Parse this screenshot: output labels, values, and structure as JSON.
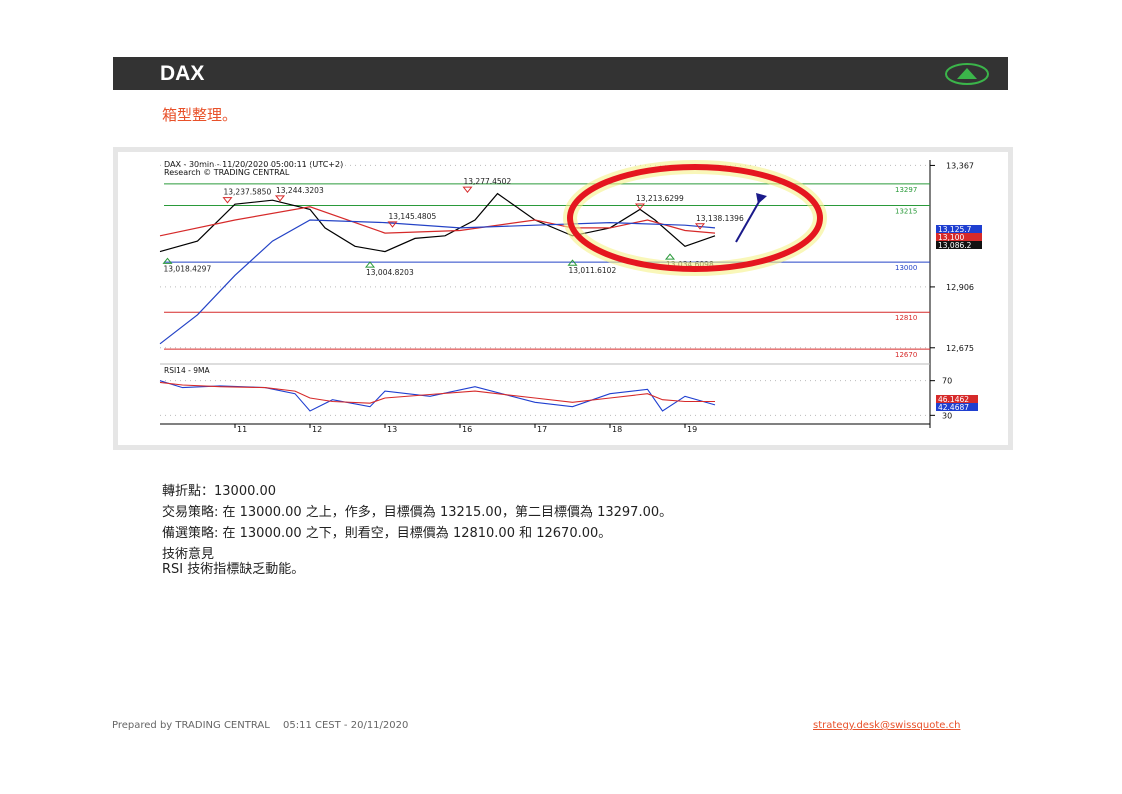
{
  "header": {
    "title": "DAX",
    "trend_icon": "up-arrow-icon",
    "trend_color": "#3bb54a"
  },
  "subtitle": "箱型整理。",
  "chart_data": {
    "type": "line",
    "title": "DAX - 30min - 11/20/2020 05:00:11 (UTC+2)",
    "subtitle": "Research © TRADING CENTRAL",
    "x_ticks": [
      "11",
      "12",
      "13",
      "16",
      "17",
      "18",
      "19"
    ],
    "y_ticks": [
      "13,367",
      "13,215",
      "13,086",
      "12,906",
      "12,675"
    ],
    "ylim": [
      12640,
      13380
    ],
    "levels": [
      {
        "label": "13297",
        "value": 13297,
        "color": "#2a9a3a"
      },
      {
        "label": "13215",
        "value": 13215,
        "color": "#2a9a3a"
      },
      {
        "label": "13000",
        "value": 13000,
        "color": "#2443c6"
      },
      {
        "label": "12810",
        "value": 12810,
        "color": "#d62a2a"
      },
      {
        "label": "12670",
        "value": 12670,
        "color": "#d62a2a"
      }
    ],
    "price_tags": [
      {
        "label": "13,125.7",
        "color": "#1f3fd0"
      },
      {
        "label": "13,100",
        "color": "#d62a2a"
      },
      {
        "label": "13,086.2",
        "color": "#111111"
      }
    ],
    "annotations": [
      {
        "label": "13,237.5850",
        "value": 13237,
        "pos": 0.09,
        "dir": "high"
      },
      {
        "label": "13,244.3203",
        "value": 13244,
        "pos": 0.16,
        "dir": "high"
      },
      {
        "label": "13,277.4502",
        "value": 13277,
        "pos": 0.41,
        "dir": "high"
      },
      {
        "label": "13,145.4805",
        "value": 13145,
        "pos": 0.31,
        "dir": "high"
      },
      {
        "label": "13,213.6299",
        "value": 13213,
        "pos": 0.64,
        "dir": "high"
      },
      {
        "label": "13,138.1396",
        "value": 13138,
        "pos": 0.72,
        "dir": "high"
      },
      {
        "label": "13,018.4297",
        "value": 13018,
        "pos": 0.01,
        "dir": "low"
      },
      {
        "label": "13,004.8203",
        "value": 13004,
        "pos": 0.28,
        "dir": "low"
      },
      {
        "label": "13,011.6102",
        "value": 13011,
        "pos": 0.55,
        "dir": "low"
      },
      {
        "label": "13,034.6098",
        "value": 13034,
        "pos": 0.68,
        "dir": "low"
      }
    ],
    "series": [
      {
        "name": "",
        "color": "#000000",
        "x": [
          0,
          0.05,
          0.1,
          0.15,
          0.2,
          0.22,
          0.26,
          0.3,
          0.34,
          0.38,
          0.42,
          0.45,
          0.5,
          0.55,
          0.6,
          0.64,
          0.66,
          0.7,
          0.74
        ],
        "values": [
          13040,
          13080,
          13220,
          13235,
          13200,
          13130,
          13060,
          13040,
          13090,
          13100,
          13160,
          13260,
          13160,
          13100,
          13130,
          13200,
          13160,
          13060,
          13100
        ]
      },
      {
        "name": "",
        "color": "#d62a2a",
        "x": [
          0,
          0.1,
          0.2,
          0.3,
          0.4,
          0.5,
          0.55,
          0.6,
          0.65,
          0.7,
          0.74
        ],
        "values": [
          13100,
          13160,
          13210,
          13110,
          13120,
          13160,
          13130,
          13130,
          13160,
          13120,
          13110
        ]
      },
      {
        "name": "",
        "color": "#2443c6",
        "x": [
          0,
          0.05,
          0.1,
          0.15,
          0.2,
          0.3,
          0.4,
          0.5,
          0.6,
          0.7,
          0.74
        ],
        "values": [
          12690,
          12800,
          12950,
          13080,
          13160,
          13150,
          13130,
          13140,
          13150,
          13140,
          13130
        ]
      }
    ],
    "rsi": {
      "label": "RSI14 - 9MA",
      "y_ticks": [
        "70",
        "30"
      ],
      "tags": [
        {
          "label": "46.1462",
          "color": "#d62a2a"
        },
        {
          "label": "42.4687",
          "color": "#1f3fd0"
        }
      ],
      "x": [
        0,
        0.03,
        0.08,
        0.14,
        0.18,
        0.2,
        0.23,
        0.28,
        0.3,
        0.36,
        0.42,
        0.5,
        0.55,
        0.6,
        0.65,
        0.67,
        0.7,
        0.74
      ],
      "rsi": [
        70,
        62,
        64,
        62,
        55,
        35,
        48,
        40,
        58,
        52,
        63,
        45,
        40,
        55,
        60,
        35,
        52,
        42
      ],
      "ma": [
        68,
        65,
        63,
        62,
        58,
        50,
        46,
        44,
        50,
        54,
        58,
        50,
        45,
        50,
        55,
        48,
        46,
        46
      ]
    }
  },
  "body": {
    "pivot": "轉折點：13000.00",
    "strategy": "交易策略: 在 13000.00 之上，作多，目標價為 13215.00，第二目標價為 13297.00。",
    "alt": "備選策略: 在 13000.00 之下，則看空，目標價為 12810.00 和 12670.00。",
    "opinion_title": "技術意見",
    "opinion": "RSI 技術指標缺乏動能。"
  },
  "footer": {
    "prepared": "Prepared by TRADING CENTRAL",
    "time": "05:11 CEST - 20/11/2020",
    "email": "strategy.desk@swissquote.ch"
  }
}
